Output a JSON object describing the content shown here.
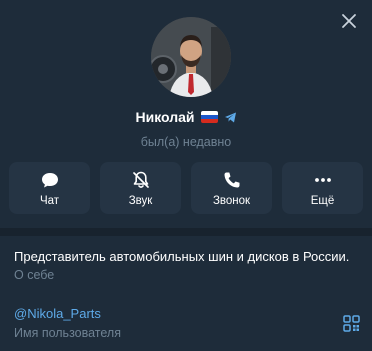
{
  "profile": {
    "name": "Николай",
    "flag": "russia-flag-emoji",
    "badge_icon": "telegram-icon",
    "status": "был(а) недавно",
    "avatar": "avatar-photo"
  },
  "actions": [
    {
      "label": "Чат",
      "icon": "chat-icon"
    },
    {
      "label": "Звук",
      "icon": "bell-muted-icon"
    },
    {
      "label": "Звонок",
      "icon": "phone-icon"
    },
    {
      "label": "Ещё",
      "icon": "more-icon"
    }
  ],
  "info": {
    "bio": "Представитель автомобильных шин и дисков в России.",
    "bio_label": "О себе",
    "username": "@Nikola_Parts",
    "username_label": "Имя пользователя"
  },
  "colors": {
    "background": "#1e2c3a",
    "card": "#253444",
    "accent": "#5eaae8",
    "muted": "#6f8293"
  }
}
